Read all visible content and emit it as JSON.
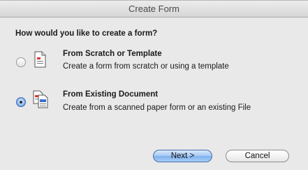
{
  "window": {
    "title": "Create Form"
  },
  "prompt": {
    "question": "How would you like to create a form?"
  },
  "options": [
    {
      "title": "From Scratch or Template",
      "description": "Create a form from scratch or using a template",
      "selected": false,
      "icon": "blank-document-icon"
    },
    {
      "title": "From Existing Document",
      "description": "Create from a scanned paper form or an existing File",
      "selected": true,
      "icon": "existing-document-icon"
    }
  ],
  "buttons": {
    "next_label": "Next >",
    "cancel_label": "Cancel"
  },
  "colors": {
    "accent": "#3f77c7",
    "icon_red": "#d9372f",
    "icon_blue": "#3b6fd1"
  }
}
